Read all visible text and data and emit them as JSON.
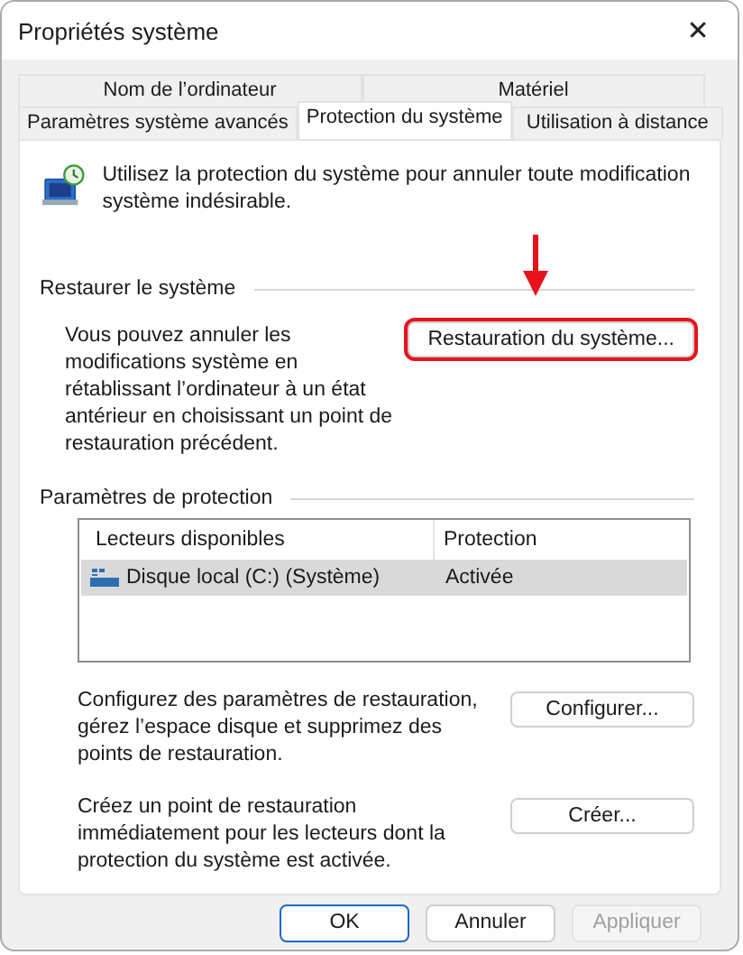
{
  "window": {
    "title": "Propriétés système",
    "close": "✕"
  },
  "tab_rows": [
    [
      {
        "label": "Nom de l’ordinateur",
        "selected": false
      },
      {
        "label": "Matériel",
        "selected": false
      }
    ],
    [
      {
        "label": "Paramètres système avancés",
        "selected": false
      },
      {
        "label": "Protection du système",
        "selected": true
      },
      {
        "label": "Utilisation à distance",
        "selected": false
      }
    ]
  ],
  "intro": "Utilisez la protection du système pour annuler toute modification système indésirable.",
  "restore": {
    "heading": "Restaurer le système",
    "description": "Vous pouvez annuler les modifications système en rétablissant l’ordinateur à un état antérieur en choisissant un point de restauration précédent.",
    "button": {
      "label": "Restauration du système...",
      "highlighted": true
    }
  },
  "protection": {
    "heading": "Paramètres de protection",
    "columns": [
      "Lecteurs disponibles",
      "Protection"
    ],
    "rows": [
      {
        "cells": [
          "Disque local (C:) (Système)",
          "Activée"
        ],
        "selected": true
      }
    ],
    "actions": [
      {
        "description": "Configurez des paramètres de restauration, gérez l’espace disque et supprimez des points de restauration.",
        "button": "Configurer..."
      },
      {
        "description": "Créez un point de restauration immédiatement pour les lecteurs dont la protection du système est activée.",
        "button": "Créer..."
      }
    ]
  },
  "buttons": [
    {
      "label": "OK",
      "default": true,
      "disabled": false
    },
    {
      "label": "Annuler",
      "default": false,
      "disabled": false
    },
    {
      "label": "Appliquer",
      "default": false,
      "disabled": true
    }
  ]
}
